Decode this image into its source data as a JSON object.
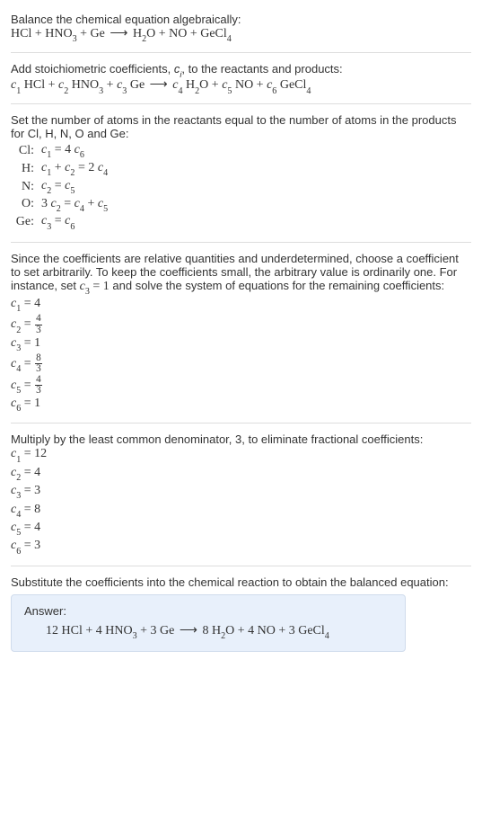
{
  "intro1": "Balance the chemical equation algebraically:",
  "eq1": "HCl + HNO₃ + Ge  ⟶  H₂O + NO + GeCl₄",
  "intro2_a": "Add stoichiometric coefficients, ",
  "intro2_var": "cᵢ",
  "intro2_b": ", to the reactants and products:",
  "eq2": "c₁ HCl + c₂ HNO₃ + c₃ Ge  ⟶  c₄ H₂O + c₅ NO + c₆ GeCl₄",
  "intro3": "Set the number of atoms in the reactants equal to the number of atoms in the products for Cl, H, N, O and Ge:",
  "elements": [
    {
      "label": "Cl:",
      "eq": "c₁ = 4 c₆"
    },
    {
      "label": "H:",
      "eq": "c₁ + c₂ = 2 c₄"
    },
    {
      "label": "N:",
      "eq": "c₂ = c₅"
    },
    {
      "label": "O:",
      "eq": "3 c₂ = c₄ + c₅"
    },
    {
      "label": "Ge:",
      "eq": "c₃ = c₆"
    }
  ],
  "intro4_a": "Since the coefficients are relative quantities and underdetermined, choose a coefficient to set arbitrarily. To keep the coefficients small, the arbitrary value is ordinarily one. For instance, set ",
  "intro4_var": "c₃ = 1",
  "intro4_b": " and solve the system of equations for the remaining coefficients:",
  "coeffs_frac": {
    "c1": "c₁ = 4",
    "c2_pre": "c₂ = ",
    "c2_num": "4",
    "c2_den": "3",
    "c3": "c₃ = 1",
    "c4_pre": "c₄ = ",
    "c4_num": "8",
    "c4_den": "3",
    "c5_pre": "c₅ = ",
    "c5_num": "4",
    "c5_den": "3",
    "c6": "c₆ = 1"
  },
  "intro5": "Multiply by the least common denominator, 3, to eliminate fractional coefficients:",
  "coeffs_int": [
    "c₁ = 12",
    "c₂ = 4",
    "c₃ = 3",
    "c₄ = 8",
    "c₅ = 4",
    "c₆ = 3"
  ],
  "intro6": "Substitute the coefficients into the chemical reaction to obtain the balanced equation:",
  "answer_label": "Answer:",
  "answer_eq": "12 HCl + 4 HNO₃ + 3 Ge  ⟶  8 H₂O + 4 NO + 3 GeCl₄",
  "chart_data": {
    "type": "table",
    "title": "Balanced chemical equation coefficients",
    "reaction_unbalanced": "HCl + HNO3 + Ge -> H2O + NO + GeCl4",
    "element_balance": [
      {
        "element": "Cl",
        "equation": "c1 = 4 c6"
      },
      {
        "element": "H",
        "equation": "c1 + c2 = 2 c4"
      },
      {
        "element": "N",
        "equation": "c2 = c5"
      },
      {
        "element": "O",
        "equation": "3 c2 = c4 + c5"
      },
      {
        "element": "Ge",
        "equation": "c3 = c6"
      }
    ],
    "solution_with_c3_eq_1": {
      "c1": 4,
      "c2": "4/3",
      "c3": 1,
      "c4": "8/3",
      "c5": "4/3",
      "c6": 1
    },
    "lcm": 3,
    "integer_solution": {
      "c1": 12,
      "c2": 4,
      "c3": 3,
      "c4": 8,
      "c5": 4,
      "c6": 3
    },
    "reaction_balanced": "12 HCl + 4 HNO3 + 3 Ge -> 8 H2O + 4 NO + 3 GeCl4"
  }
}
